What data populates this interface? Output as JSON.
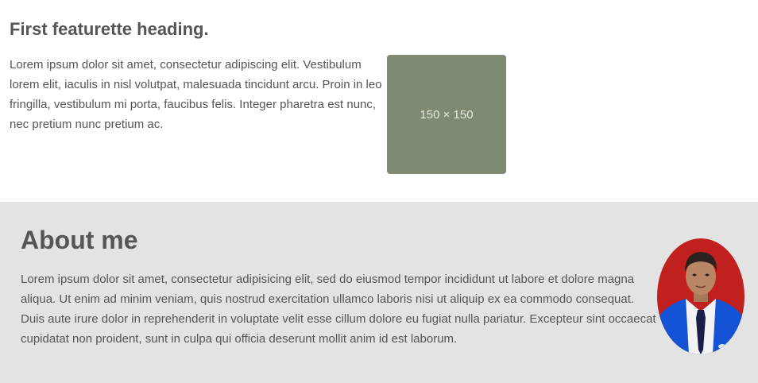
{
  "featurette": {
    "heading": "First featurette heading.",
    "text": "Lorem ipsum dolor sit amet, consectetur adipiscing elit. Vestibulum lorem elit, iaculis in nisl volutpat, malesuada tincidunt arcu. Proin in leo fringilla, vestibulum mi porta, faucibus felis. Integer pharetra est nunc, nec pretium nunc pretium ac.",
    "placeholder_label": "150 × 150"
  },
  "about": {
    "heading": "About me",
    "text": "Lorem ipsum dolor sit amet, consectetur adipisicing elit, sed do eiusmod tempor incididunt ut labore et dolore magna aliqua. Ut enim ad minim veniam, quis nostrud exercitation ullamco laboris nisi ut aliquip ex ea commodo consequat. Duis aute irure dolor in reprehenderit in voluptate velit esse cillum dolore eu fugiat nulla pariatur. Excepteur sint occaecat cupidatat non proident, sunt in culpa qui officia deserunt mollit anim id est laborum.",
    "avatar_icon": "person-photo-icon"
  },
  "colors": {
    "placeholder_bg": "#7e8a72",
    "about_bg": "#e3e3e3",
    "avatar_bg": "#c0201e",
    "jacket": "#1553d6"
  }
}
